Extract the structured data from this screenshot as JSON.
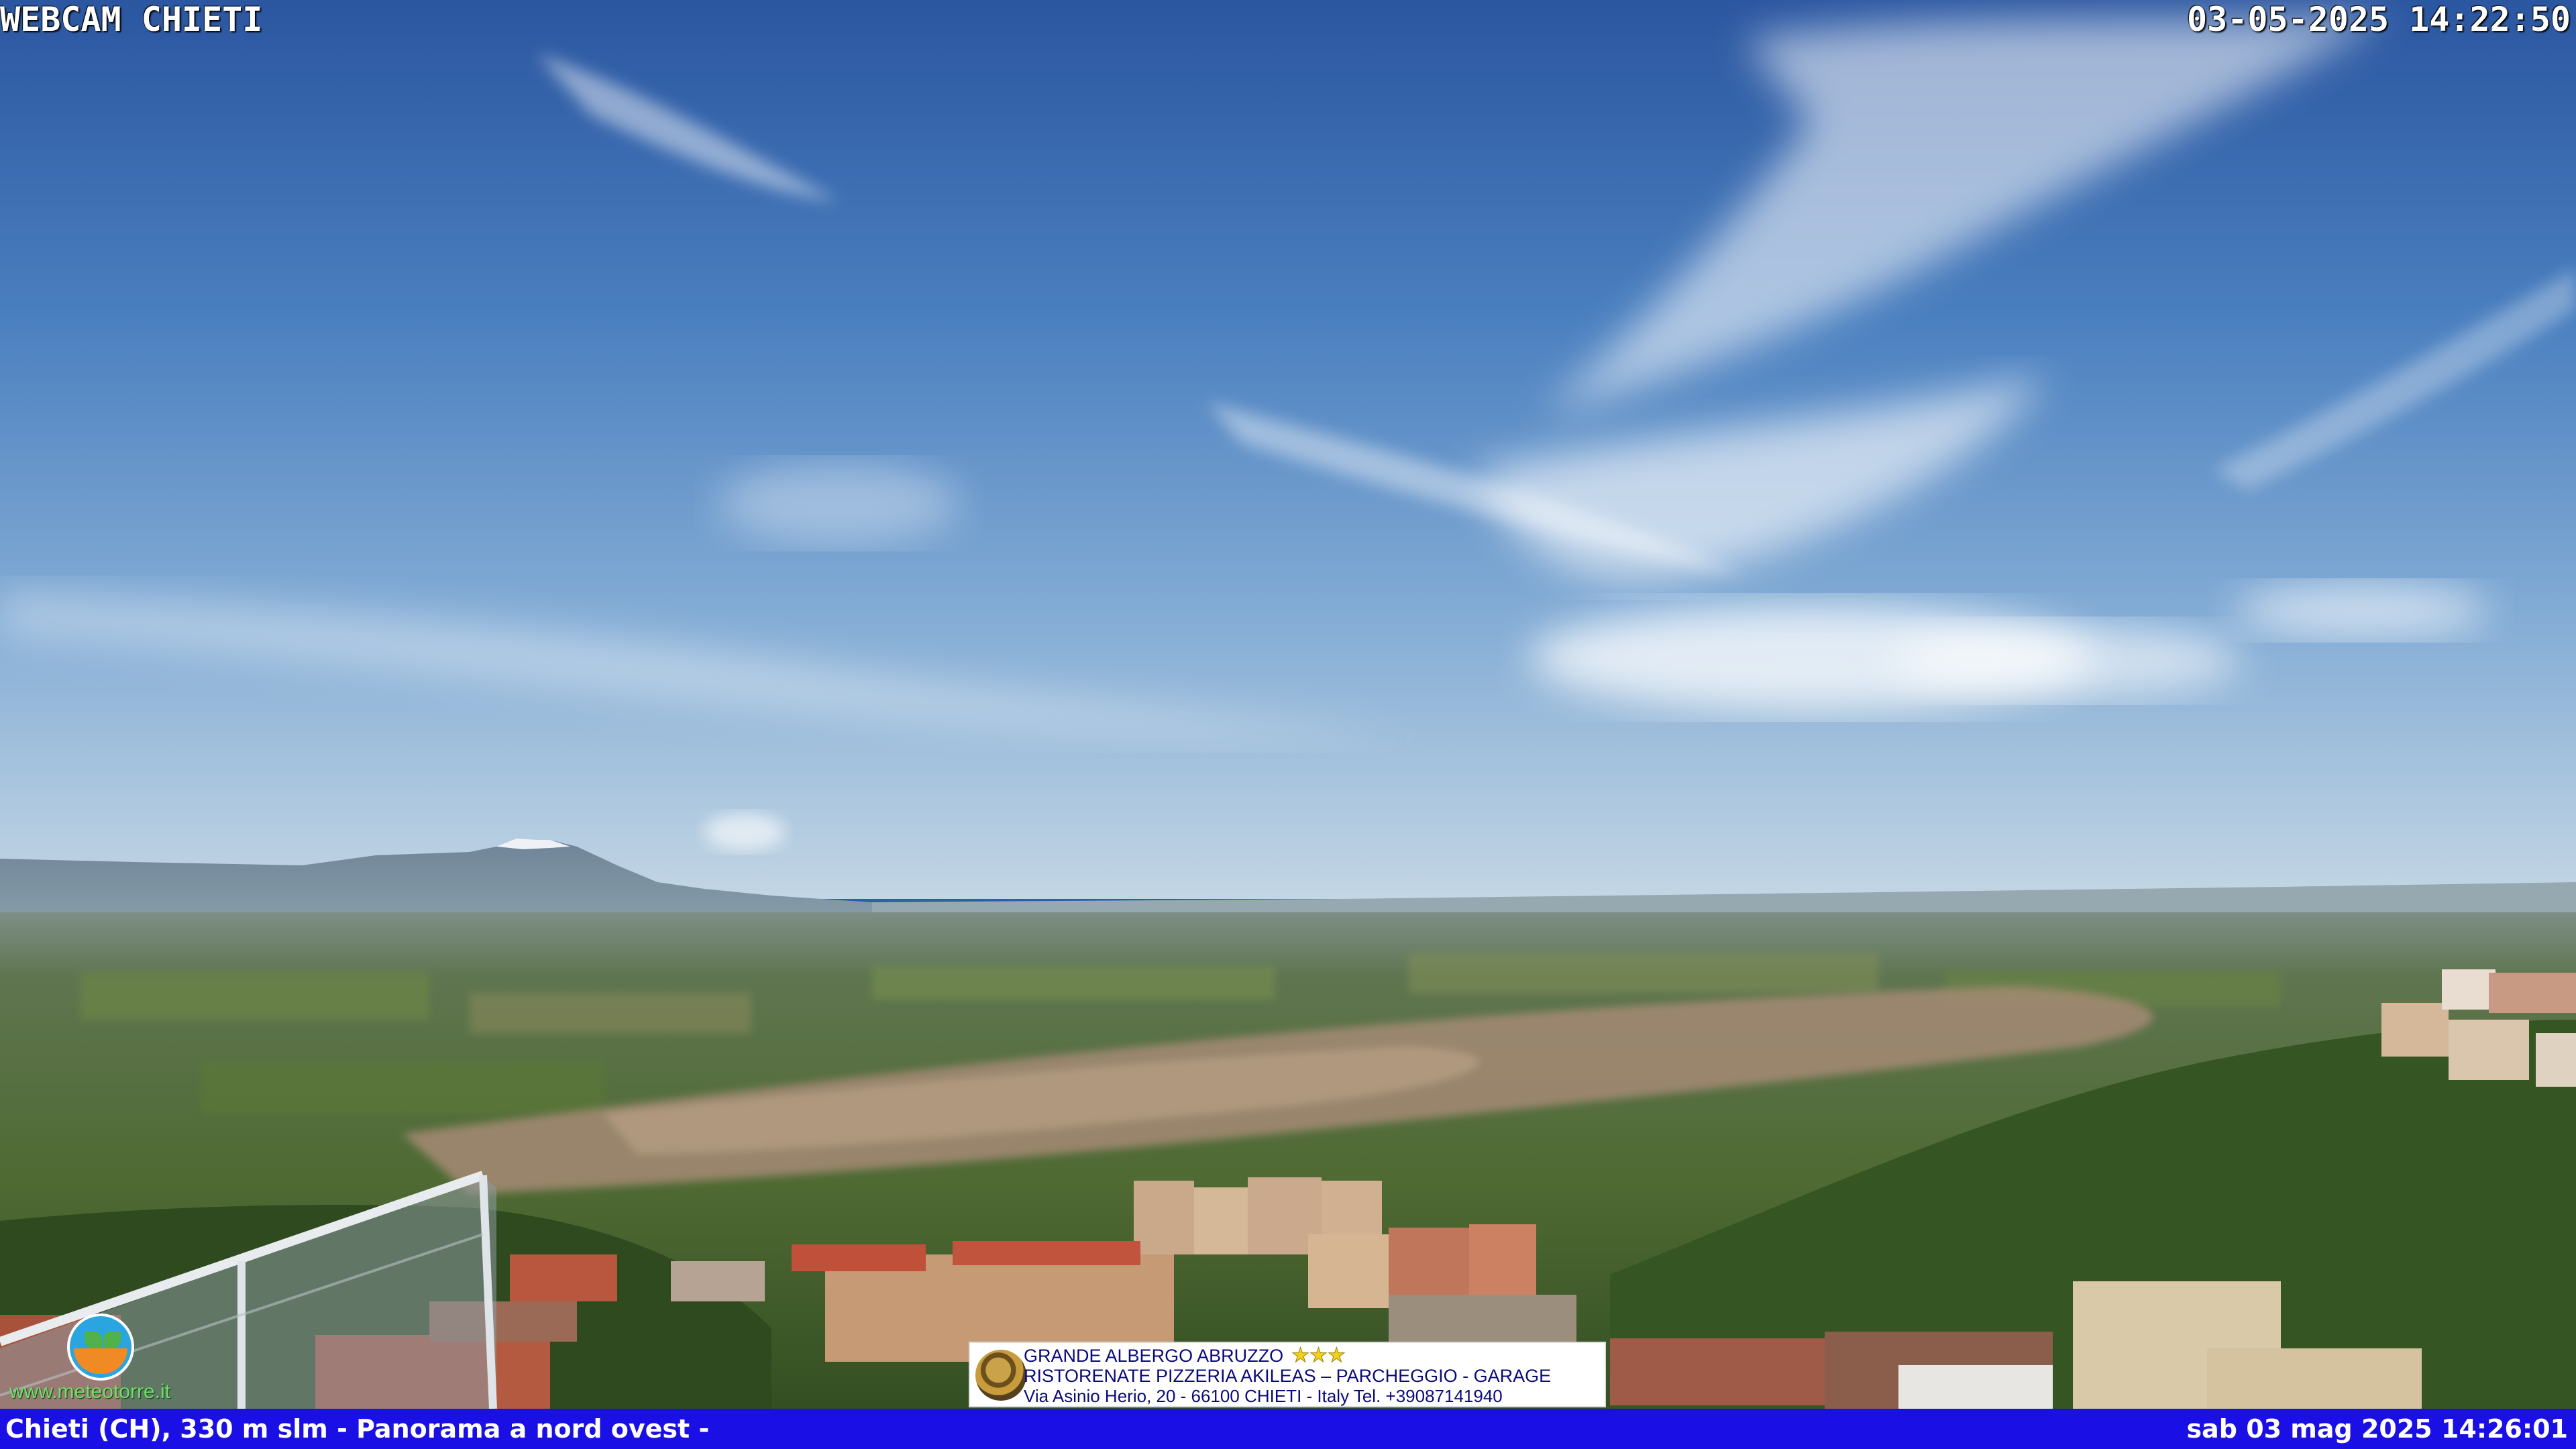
{
  "overlay": {
    "title": "WEBCAM CHIETI",
    "timestamp": "03-05-2025 14:22:50"
  },
  "bottom_bar": {
    "left_text": "Chieti (CH), 330 m slm - Panorama a nord ovest -",
    "right_text": "sab 03 mag 2025 14:26:01",
    "color": "#1a10e6"
  },
  "ad_banner": {
    "line1": "GRANDE ALBERGO ABRUZZO",
    "stars": "★★★",
    "line2": "RISTORENATE PIZZERIA AKILEAS – PARCHEGGIO - GARAGE",
    "line3": "Via Asinio Herio, 20 - 66100 CHIETI - Italy Tel. +39087141940"
  },
  "logo": {
    "url": "www.meteotorre.it"
  },
  "scene": {
    "sky_color": "#2e5fa8",
    "horizon_color": "#b9cfe0",
    "land_color": "#4f6b34"
  }
}
